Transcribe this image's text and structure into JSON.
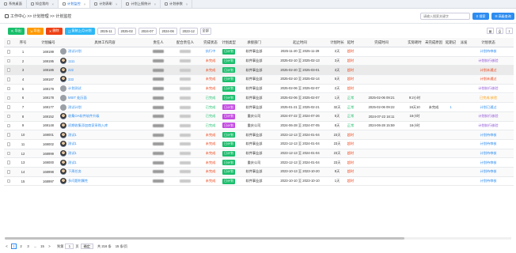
{
  "tabs": [
    {
      "label": "系统桌面",
      "active": false
    },
    {
      "label": "知会我的",
      "active": false
    },
    {
      "label": "计划监控",
      "active": true
    },
    {
      "label": "计划表彰",
      "active": false
    },
    {
      "label": "计划上报统计",
      "active": false
    },
    {
      "label": "计划参数",
      "active": false
    }
  ],
  "breadcrumb": "工作中心 >> 计划管理 >> 计划监控",
  "search": {
    "placeholder": "请输入搜索关键字"
  },
  "query_label": "搜索",
  "advanced_label": "高级查询",
  "toolbar": {
    "export": "导出",
    "import": "导出",
    "delete": "删除",
    "copy": "复制上月计划",
    "months": [
      "2025-11",
      "2025-02",
      "2024-07",
      "2024-06",
      "2023-12"
    ],
    "all": "全部"
  },
  "columns": [
    "序号",
    "计划编号",
    "具体工作内容",
    "责任人",
    "配合责任人",
    "完成状态",
    "计划类型",
    "承接部门",
    "起止时间",
    "计划时长",
    "延时",
    "完成时间",
    "实际耗时",
    "未完成原因",
    "延期记",
    "派发",
    "计划状态"
  ],
  "rows": [
    {
      "no": "1",
      "code": "169199",
      "content": "测试计划",
      "avatar": "gray",
      "status": "执行中",
      "status_color": "blue",
      "type": "日计划",
      "type_color": "green",
      "dept": "软件事业部",
      "period": "2025-11-20 至 2025-11-29",
      "dur": "2天",
      "delay": "超时",
      "delay_color": "red",
      "done": "",
      "actual": "",
      "reason": "",
      "ext": "",
      "dispatch": "",
      "plan_state": "计划待审核",
      "plan_state_color": "blue"
    },
    {
      "no": "2",
      "code": "169195",
      "content": "1111",
      "avatar": "photo",
      "status": "未完成",
      "status_color": "red",
      "type": "日计划",
      "type_color": "green",
      "dept": "软件事业部",
      "period": "2025-02-10 至 2025-02-13",
      "dur": "3天",
      "delay": "超时",
      "delay_color": "red",
      "done": "",
      "actual": "",
      "reason": "",
      "ext": "",
      "dispatch": "",
      "plan_state": "计划执行核验",
      "plan_state_color": "purple"
    },
    {
      "no": "3",
      "code": "169186",
      "content": "222",
      "avatar": "photo",
      "status": "未完成",
      "status_color": "red",
      "type": "日计划",
      "type_color": "green",
      "dept": "软件事业部",
      "period": "2025-02-20 至 2025-03-01",
      "dur": "3天",
      "delay": "超时",
      "delay_color": "red",
      "done": "",
      "actual": "",
      "reason": "",
      "ext": "",
      "dispatch": "",
      "plan_state": "计划未通过",
      "plan_state_color": "red"
    },
    {
      "no": "4",
      "code": "169187",
      "content": "333",
      "avatar": "photo",
      "status": "未完成",
      "status_color": "red",
      "type": "日计划",
      "type_color": "green",
      "dept": "软件事业部",
      "period": "2025-02-10 至 2025-02-14",
      "dur": "5天",
      "delay": "超时",
      "delay_color": "red",
      "done": "",
      "actual": "",
      "reason": "",
      "ext": "",
      "dispatch": "",
      "plan_state": "计划未通过",
      "plan_state_color": "red"
    },
    {
      "no": "5",
      "code": "169179",
      "content": "计划测试",
      "avatar": "gray",
      "status": "未完成",
      "status_color": "red",
      "type": "日计划",
      "type_color": "green",
      "dept": "软件事业部",
      "period": "2025-02-06 至 2025-02-07",
      "dur": "2天",
      "delay": "超时",
      "delay_color": "red",
      "done": "",
      "actual": "",
      "reason": "",
      "ext": "",
      "dispatch": "",
      "plan_state": "计划执行核验",
      "plan_state_color": "purple"
    },
    {
      "no": "6",
      "code": "169178",
      "content": "MSIT 处历面",
      "avatar": "gray",
      "status": "已完成",
      "status_color": "green",
      "type": "日计划",
      "type_color": "green",
      "dept": "软件事业部",
      "period": "2025-02-06 至 2025-02-07",
      "dur": "1天",
      "delay": "正常",
      "delay_color": "green",
      "done": "2025-02-06 09:21",
      "actual": "9:2小时",
      "reason": "",
      "ext": "",
      "dispatch": "",
      "plan_state": "已完成 核验",
      "plan_state_color": "orange"
    },
    {
      "no": "7",
      "code": "169177",
      "content": "测试计划",
      "avatar": "gray",
      "status": "已完成",
      "status_color": "green",
      "type": "日计划",
      "type_color": "purple",
      "dept": "软件事业部",
      "period": "2025-01-21 至 2025-02-21",
      "dur": "32天",
      "delay": "正常",
      "delay_color": "green",
      "done": "2025-02-06 09:22",
      "actual": "16天10",
      "reason": "未完成",
      "ext": "1",
      "dispatch": "",
      "plan_state": "计划已通过",
      "plan_state_color": "blue"
    },
    {
      "no": "8",
      "code": "169152",
      "content": "收集OA软件软件升级",
      "avatar": "photo",
      "status": "已完成",
      "status_color": "green",
      "type": "日计划",
      "type_color": "purple",
      "dept": "重庆公司",
      "period": "2024-07-22 至 2024-07-26",
      "dur": "5天",
      "delay": "正常",
      "delay_color": "green",
      "done": "2024-07-22 16:11",
      "actual": "16小时",
      "reason": "",
      "ext": "",
      "dispatch": "",
      "plan_state": "计划执行核验",
      "plan_state_color": "purple"
    },
    {
      "no": "9",
      "code": "169148",
      "content": "初期收集添加商家采购入库",
      "avatar": "photo",
      "status": "已完成",
      "status_color": "green",
      "type": "日计划",
      "type_color": "purple",
      "dept": "重庆公司",
      "period": "2024-06-28 至 2024-07-05",
      "dur": "8天",
      "delay": "正常",
      "delay_color": "green",
      "done": "2024-06-28 15:59",
      "actual": "16小时",
      "reason": "",
      "ext": "",
      "dispatch": "",
      "plan_state": "计划执行核验",
      "plan_state_color": "purple"
    },
    {
      "no": "10",
      "code": "169001",
      "content": "测试1",
      "avatar": "photo",
      "status": "未完成",
      "status_color": "red",
      "type": "日计划",
      "type_color": "green",
      "dept": "软件事业部",
      "period": "2023-12-13 至 2024-01-04",
      "dur": "23天",
      "delay": "超时",
      "delay_color": "red",
      "done": "",
      "actual": "",
      "reason": "",
      "ext": "",
      "dispatch": "",
      "plan_state": "计划待审核",
      "plan_state_color": "blue"
    },
    {
      "no": "11",
      "code": "169002",
      "content": "测试1",
      "avatar": "photo",
      "status": "未完成",
      "status_color": "red",
      "type": "日计划",
      "type_color": "green",
      "dept": "软件事业部",
      "period": "2023-12-13 至 2024-01-04",
      "dur": "23天",
      "delay": "超时",
      "delay_color": "red",
      "done": "",
      "actual": "",
      "reason": "",
      "ext": "",
      "dispatch": "",
      "plan_state": "计划待审核",
      "plan_state_color": "blue"
    },
    {
      "no": "12",
      "code": "168999",
      "content": "测试1",
      "avatar": "photo",
      "status": "未完成",
      "status_color": "red",
      "type": "日计划",
      "type_color": "green",
      "dept": "软件事业部",
      "period": "2023-12-13 至 2024-01-04",
      "dur": "23天",
      "delay": "超时",
      "delay_color": "red",
      "done": "",
      "actual": "",
      "reason": "",
      "ext": "",
      "dispatch": "",
      "plan_state": "计划待审核",
      "plan_state_color": "blue"
    },
    {
      "no": "13",
      "code": "169000",
      "content": "测试1",
      "avatar": "photo",
      "status": "未完成",
      "status_color": "red",
      "type": "日计划",
      "type_color": "green",
      "dept": "重庆公司",
      "period": "2023-12-13 至 2024-01-04",
      "dur": "23天",
      "delay": "超时",
      "delay_color": "red",
      "done": "",
      "actual": "",
      "reason": "",
      "ext": "",
      "dispatch": "",
      "plan_state": "计划待审核",
      "plan_state_color": "blue"
    },
    {
      "no": "14",
      "code": "168998",
      "content": "下周任务",
      "avatar": "photo",
      "status": "未完成",
      "status_color": "red",
      "type": "日计划",
      "type_color": "green",
      "dept": "软件事业部",
      "period": "2023-10-13 至 2023-10-20",
      "dur": "8天",
      "delay": "超时",
      "delay_color": "red",
      "done": "",
      "actual": "",
      "reason": "",
      "ext": "",
      "dispatch": "",
      "plan_state": "计划待审核",
      "plan_state_color": "blue"
    },
    {
      "no": "15",
      "code": "168997",
      "content": "多问题附属性",
      "avatar": "photo",
      "status": "未完成",
      "status_color": "red",
      "type": "日计划",
      "type_color": "green",
      "dept": "软件事业部",
      "period": "2023-10-10 至 2023-10-10",
      "dur": "1天",
      "delay": "超时",
      "delay_color": "red",
      "done": "",
      "actual": "",
      "reason": "",
      "ext": "",
      "dispatch": "",
      "plan_state": "计划待审核",
      "plan_state_color": "blue"
    }
  ],
  "pager": {
    "prev": "<",
    "pages": [
      "1",
      "2",
      "3",
      "...",
      "15"
    ],
    "next": ">",
    "goto_prefix": "到第",
    "goto_value": "1",
    "goto_suffix": "页",
    "confirm": "确定",
    "total": "共 216 条",
    "size": "15 条/页"
  }
}
